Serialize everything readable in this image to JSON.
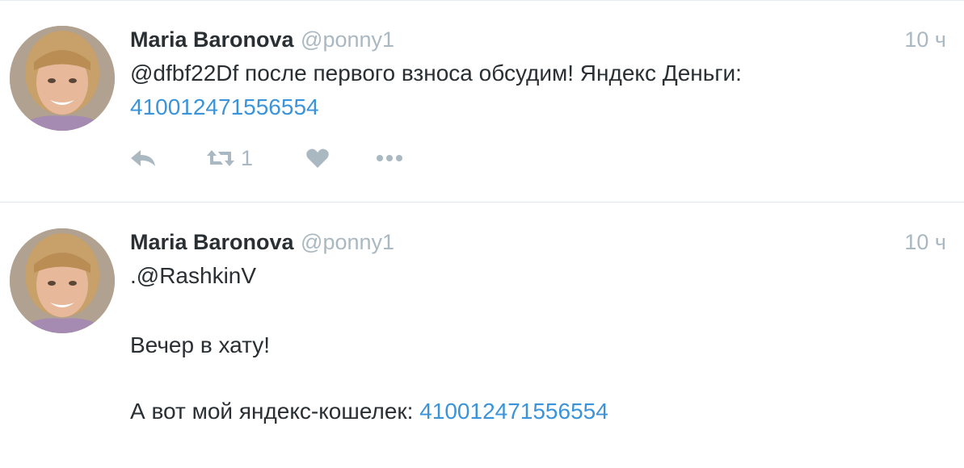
{
  "tweets": [
    {
      "author_name": "Maria Baronova",
      "author_handle": "@ponny1",
      "time": "10 ч",
      "text_lines": [
        "@dfbf22Df после первого взноса обсудим! Яндекс Деньги:"
      ],
      "link": "410012471556554",
      "retweet_count": "1"
    },
    {
      "author_name": "Maria Baronova",
      "author_handle": "@ponny1",
      "time": "10 ч",
      "text_lines": [
        ".@RashkinV",
        "Вечер в хату!",
        "А вот мой яндекс-кошелек: "
      ],
      "link": "410012471556554"
    }
  ],
  "icons": {
    "reply": "reply-icon",
    "retweet": "retweet-icon",
    "like": "heart-icon",
    "more": "more-icon",
    "avatar": "avatar"
  },
  "colors": {
    "link": "#3b94d9",
    "muted": "#aab8c2",
    "text": "#292f33"
  }
}
